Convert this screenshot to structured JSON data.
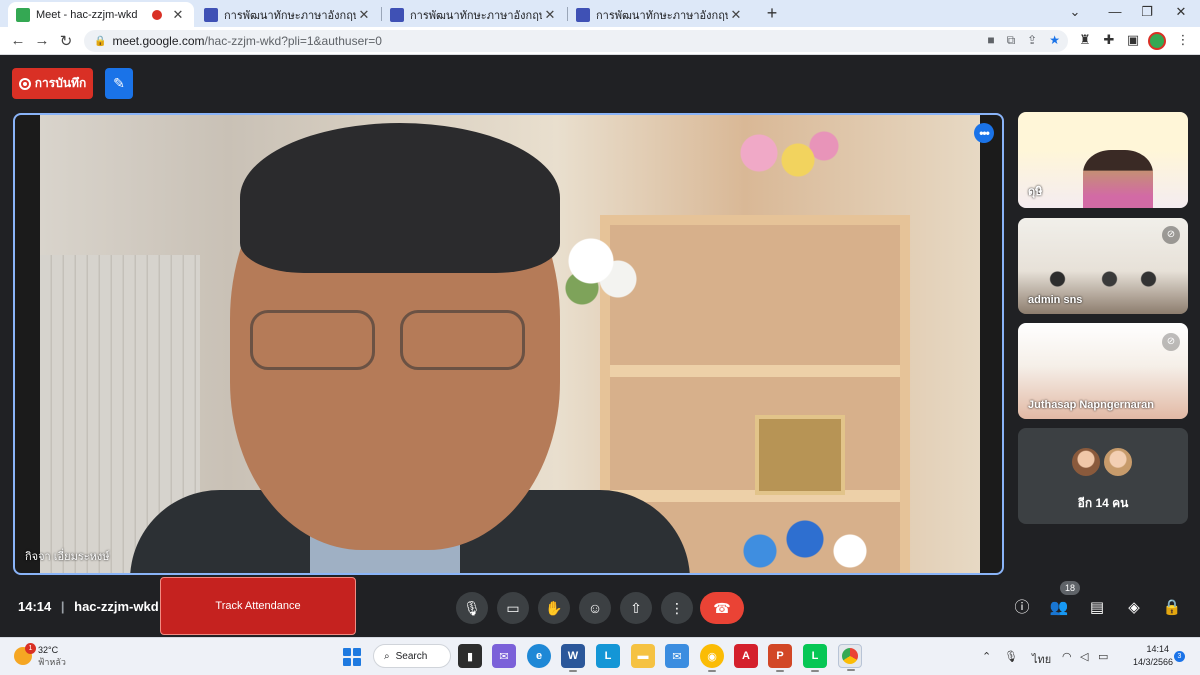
{
  "browser": {
    "tabs": [
      {
        "title": "Meet - hac-zzjm-wkd",
        "active": true,
        "recording": true
      },
      {
        "title": "การพัฒนาทักษะภาษาอังกฤษ English",
        "active": false
      },
      {
        "title": "การพัฒนาทักษะภาษาอังกฤษ English",
        "active": false
      },
      {
        "title": "การพัฒนาทักษะภาษาอังกฤษ English",
        "active": false
      }
    ],
    "url_host": "meet.google.com",
    "url_path": "/hac-zzjm-wkd?pli=1&authuser=0",
    "colors": {
      "tab_bar": "#dde8f8",
      "meet_favicon": "#34a853",
      "forms_favicon": "#3f51b5"
    }
  },
  "meet": {
    "record_label": "การบันทึก",
    "main_speaker_name": "กิจจา เอี่ยมระหงษ์",
    "participants": [
      {
        "name": "ดุษิ",
        "muted": false
      },
      {
        "name": "admin sns",
        "muted": true
      },
      {
        "name": "Juthasap Napngernaran",
        "muted": true
      }
    ],
    "others_label": "อีก 14 คน",
    "time": "14:14",
    "meeting_code": "hac-zzjm-wkd",
    "track_attendance_label": "Track Attendance",
    "participant_count": "18",
    "colors": {
      "accent": "#1a73e8",
      "danger": "#ea4335",
      "track": "#c5221f",
      "background": "#202124",
      "speaker_border": "#8ab4f8"
    },
    "controls": [
      "mic-icon",
      "camera-icon",
      "raise-hand-icon",
      "emoji-icon",
      "present-icon",
      "more-options-icon",
      "end-call-icon"
    ],
    "right_controls": [
      "info-icon",
      "people-icon",
      "chat-icon",
      "activities-icon",
      "host-controls-icon"
    ]
  },
  "taskbar": {
    "weather_temp": "32°C",
    "weather_desc": "ฟ้าหลัว",
    "weather_badge": "1",
    "search_label": "Search",
    "language": "ไทย",
    "clock_time": "14:14",
    "clock_date": "14/3/2566",
    "notification_count": "3",
    "apps": [
      "file-explorer-icon",
      "teams-chat-icon",
      "edge-icon",
      "word-icon",
      "l-app-icon",
      "folder-icon",
      "mail-icon",
      "chrome-beta-icon",
      "acrobat-icon",
      "powerpoint-icon",
      "line-icon",
      "chrome-icon"
    ]
  }
}
